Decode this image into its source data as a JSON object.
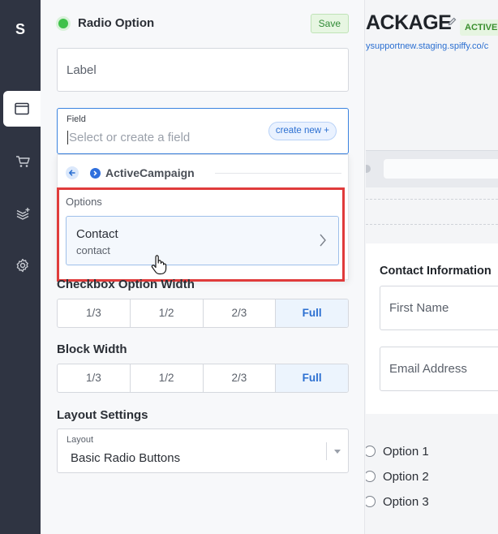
{
  "app": {
    "logo_letter": "S"
  },
  "sidebar": {
    "items": [
      {
        "icon": "browser-window-icon",
        "active": true
      },
      {
        "icon": "cart-icon",
        "active": false
      },
      {
        "icon": "layers-add-icon",
        "active": false
      },
      {
        "icon": "gear-icon",
        "active": false
      }
    ]
  },
  "editor": {
    "title": "Radio Option",
    "save_label": "Save",
    "label_placeholder": "Label",
    "field": {
      "label": "Field",
      "placeholder": "Select or create a field",
      "create_new_label": "create new +"
    },
    "dropdown": {
      "integration": "ActiveCampaign",
      "options_label": "Options",
      "option": {
        "title": "Contact",
        "subtitle": "contact"
      }
    },
    "checkbox_width": {
      "title": "Checkbox Option Width",
      "options": [
        "1/3",
        "1/2",
        "2/3",
        "Full"
      ],
      "selected": "Full"
    },
    "block_width": {
      "title": "Block Width",
      "options": [
        "1/3",
        "1/2",
        "2/3",
        "Full"
      ],
      "selected": "Full"
    },
    "layout": {
      "title": "Layout Settings",
      "field_label": "Layout",
      "value": "Basic Radio Buttons"
    }
  },
  "preview": {
    "title": "ACKAGE",
    "status_badge": "ACTIVE",
    "url": "ysupportnew.staging.spiffy.co/c",
    "section_title": "Contact Information",
    "first_name_placeholder": "First Name",
    "email_placeholder": "Email Address",
    "radio_options": [
      "Option 1",
      "Option 2",
      "Option 3"
    ]
  },
  "colors": {
    "rail": "#2f3442",
    "accent": "#3b83e0",
    "highlight": "#e03b3b",
    "active_green": "#3fc14a"
  }
}
